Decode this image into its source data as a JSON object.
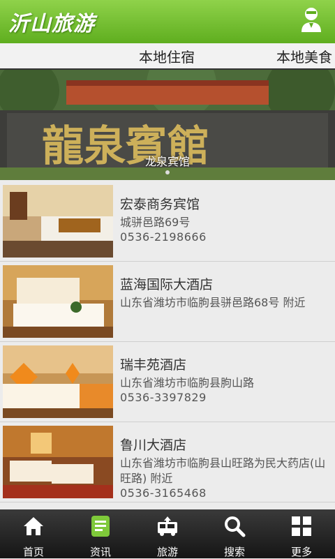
{
  "header": {
    "app_title": "沂山旅游",
    "user_icon": "user-icon"
  },
  "tabs": [
    {
      "label": "本地住宿",
      "active": true
    },
    {
      "label": "本地美食",
      "active": false
    }
  ],
  "banner": {
    "caption": "龙泉宾馆",
    "sign_text": "龍泉賓館"
  },
  "hotels": [
    {
      "name": "宏泰商务宾馆",
      "address": "城骈邑路69号",
      "phone": "0536-2198666"
    },
    {
      "name": "蓝海国际大酒店",
      "address": "山东省潍坊市临朐县骈邑路68号 附近",
      "phone": ""
    },
    {
      "name": " 瑞丰苑酒店",
      "address": "山东省潍坊市临朐县朐山路",
      "phone": "0536-3397829"
    },
    {
      "name": "鲁川大酒店",
      "address": "山东省潍坊市临朐县山旺路为民大药店(山旺路) 附近",
      "phone": "0536-3165468"
    }
  ],
  "bottom_nav": [
    {
      "label": "首页",
      "icon": "home-icon"
    },
    {
      "label": "资讯",
      "icon": "news-icon"
    },
    {
      "label": "旅游",
      "icon": "bus-icon"
    },
    {
      "label": "搜索",
      "icon": "search-icon"
    },
    {
      "label": "更多",
      "icon": "more-icon"
    }
  ],
  "colors": {
    "header_green": "#6cbc28",
    "nav_active": "#7fc93a",
    "nav_bg": "#222222"
  }
}
